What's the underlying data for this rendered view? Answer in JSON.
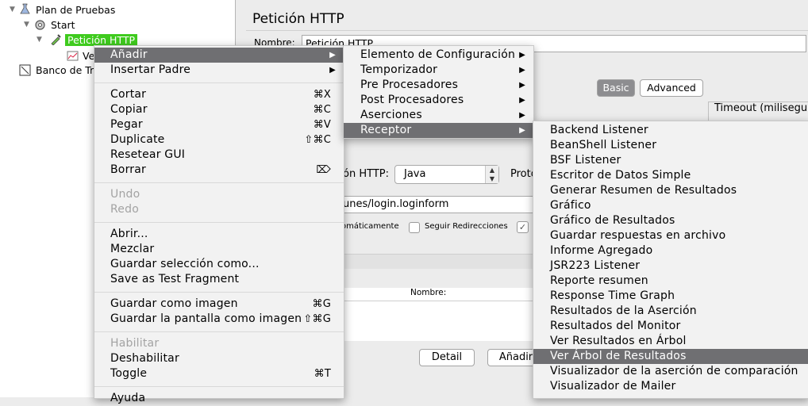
{
  "tree": {
    "items": [
      {
        "label": "Plan de Pruebas",
        "icon": "flask-icon"
      },
      {
        "label": "Start",
        "icon": "gear-icon"
      },
      {
        "label": "Petición HTTP",
        "icon": "pipette-icon"
      },
      {
        "label": "Ve",
        "icon": "graph-icon"
      },
      {
        "label": "Banco de Tra",
        "icon": "workbench-icon"
      }
    ]
  },
  "panel": {
    "title": "Petición HTTP",
    "name_label": "Nombre:",
    "name_value": "Petición HTTP",
    "tab_basic": "Basic",
    "tab_advanced": "Advanced",
    "timeout_label": "Timeout (miliseguri",
    "impl_label": "ón HTTP:",
    "impl_value": "Java",
    "proto_label": "Proto",
    "path_value": "unes/login.loginform",
    "auto_label": "omáticamente",
    "follow_label": "Seguir Redirecciones",
    "table_header": "Nombre:",
    "detail_button": "Detail",
    "add_button": "Añadir"
  },
  "menu1": {
    "items": [
      {
        "label": "Añadir",
        "submenu": true,
        "highlight": true
      },
      {
        "label": "Insertar Padre",
        "submenu": true
      },
      {
        "sep": true
      },
      {
        "label": "Cortar",
        "shortcut": "⌘X"
      },
      {
        "label": "Copiar",
        "shortcut": "⌘C"
      },
      {
        "label": "Pegar",
        "shortcut": "⌘V"
      },
      {
        "label": "Duplicate",
        "shortcut": "⇧⌘C"
      },
      {
        "label": "Resetear GUI"
      },
      {
        "label": "Borrar",
        "shortcut": "⌦"
      },
      {
        "sep": true
      },
      {
        "label": "Undo",
        "disabled": true
      },
      {
        "label": "Redo",
        "disabled": true
      },
      {
        "sep": true
      },
      {
        "label": "Abrir..."
      },
      {
        "label": "Mezclar"
      },
      {
        "label": "Guardar selección como..."
      },
      {
        "label": "Save as Test Fragment"
      },
      {
        "sep": true
      },
      {
        "label": "Guardar como imagen",
        "shortcut": "⌘G"
      },
      {
        "label": "Guardar la pantalla como imagen",
        "shortcut": "⇧⌘G"
      },
      {
        "sep": true
      },
      {
        "label": "Habilitar",
        "disabled": true
      },
      {
        "label": "Deshabilitar"
      },
      {
        "label": "Toggle",
        "shortcut": "⌘T"
      },
      {
        "sep": true
      },
      {
        "label": "Ayuda"
      }
    ]
  },
  "menu2": {
    "items": [
      {
        "label": "Elemento de Configuración",
        "submenu": true
      },
      {
        "label": "Temporizador",
        "submenu": true
      },
      {
        "label": "Pre Procesadores",
        "submenu": true
      },
      {
        "label": "Post Procesadores",
        "submenu": true
      },
      {
        "label": "Aserciones",
        "submenu": true
      },
      {
        "label": "Receptor",
        "submenu": true,
        "highlight": true
      }
    ]
  },
  "menu3": {
    "items": [
      {
        "label": "Backend Listener"
      },
      {
        "label": "BeanShell Listener"
      },
      {
        "label": "BSF Listener"
      },
      {
        "label": "Escritor de Datos Simple"
      },
      {
        "label": "Generar Resumen de Resultados"
      },
      {
        "label": "Gráfico"
      },
      {
        "label": "Gráfico de Resultados"
      },
      {
        "label": "Guardar respuestas en archivo"
      },
      {
        "label": "Informe Agregado"
      },
      {
        "label": "JSR223 Listener"
      },
      {
        "label": "Reporte resumen"
      },
      {
        "label": "Response Time Graph"
      },
      {
        "label": "Resultados de la Aserción"
      },
      {
        "label": "Resultados del Monitor"
      },
      {
        "label": "Ver Resultados en Árbol"
      },
      {
        "label": "Ver Árbol de Resultados",
        "highlight": true
      },
      {
        "label": "Visualizador de la aserción de comparación"
      },
      {
        "label": "Visualizador de Mailer"
      }
    ]
  },
  "colors": {
    "selection": "#3fcb1e",
    "menu_highlight": "#6f6f72"
  }
}
